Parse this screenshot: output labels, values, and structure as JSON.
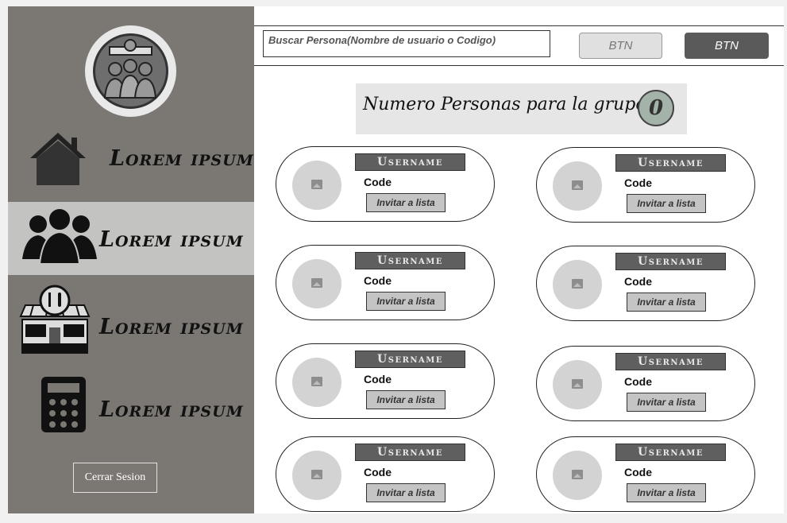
{
  "sidebar": {
    "items": [
      {
        "label": "Lorem ipsum",
        "icon": "house-icon"
      },
      {
        "label": "Lorem ipsum",
        "icon": "group-icon"
      },
      {
        "label": "Lorem ipsum",
        "icon": "restaurant-icon"
      },
      {
        "label": "Lorem ipsum",
        "icon": "calculator-icon"
      }
    ],
    "logout_label": "Cerrar Sesion"
  },
  "header": {
    "search_placeholder": "Buscar Persona(Nombre de usuario o Codigo)",
    "btn1_label": "BTN",
    "btn2_label": "BTN"
  },
  "counter": {
    "label": "Numero Personas para la grupo:",
    "value": "0"
  },
  "cards": [
    {
      "username": "Username",
      "code": "Code",
      "invite": "Invitar a lista"
    },
    {
      "username": "Username",
      "code": "Code",
      "invite": "Invitar a lista"
    },
    {
      "username": "Username",
      "code": "Code",
      "invite": "Invitar a lista"
    },
    {
      "username": "Username",
      "code": "Code",
      "invite": "Invitar a lista"
    },
    {
      "username": "Username",
      "code": "Code",
      "invite": "Invitar a lista"
    },
    {
      "username": "Username",
      "code": "Code",
      "invite": "Invitar a lista"
    },
    {
      "username": "Username",
      "code": "Code",
      "invite": "Invitar a lista"
    },
    {
      "username": "Username",
      "code": "Code",
      "invite": "Invitar a lista"
    }
  ],
  "colors": {
    "sidebar_bg": "#7b7773",
    "active_item_bg": "#c3c3c1",
    "username_bg": "#5f5f5f",
    "counter_circle": "#a3b3a9"
  }
}
